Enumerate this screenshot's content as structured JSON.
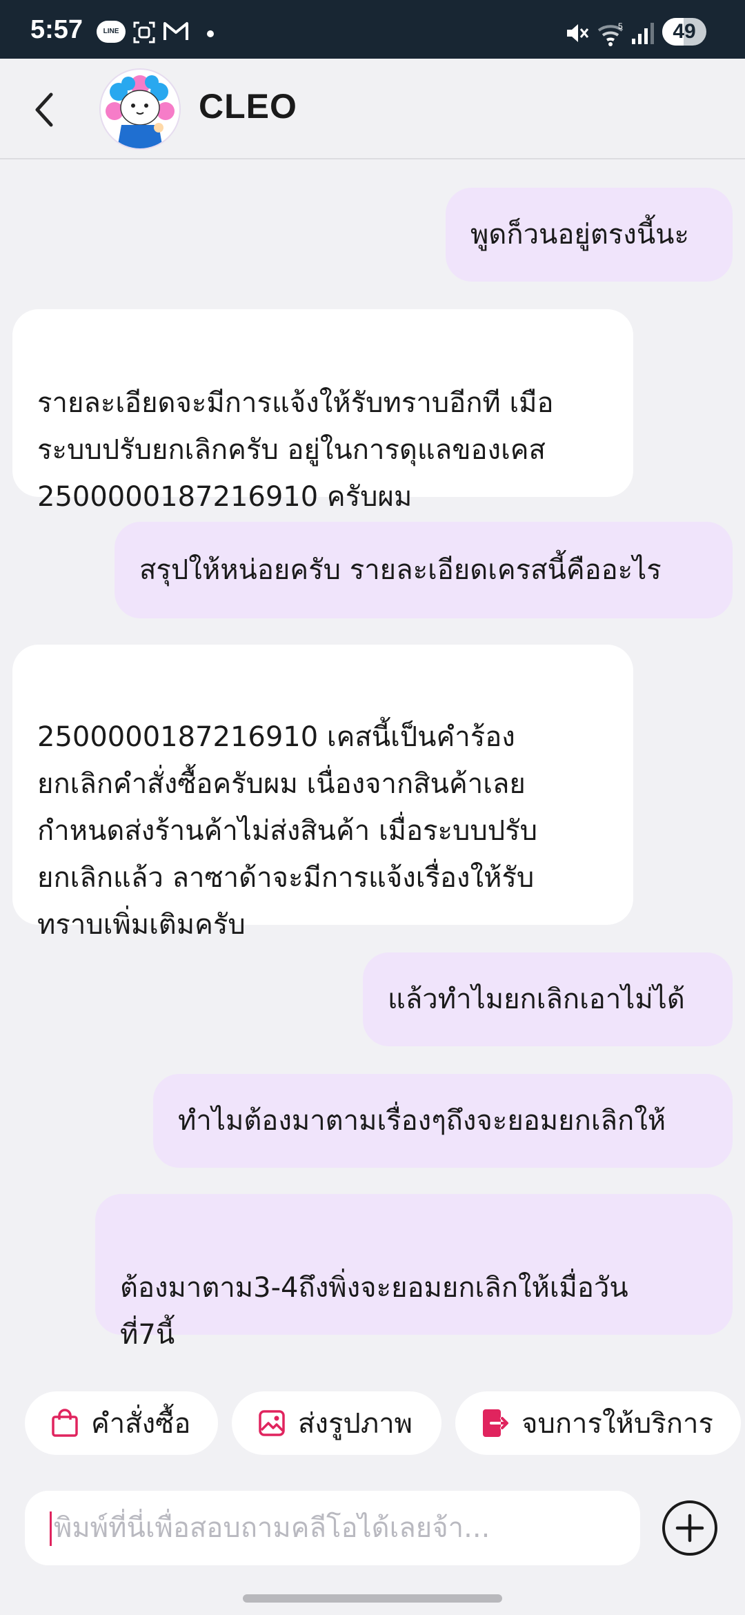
{
  "status_bar": {
    "time": "5:57",
    "line_icon_text": "LINE",
    "battery_level": "49",
    "battery_fraction": 0.49,
    "icons": [
      "line-app-icon",
      "scan-icon",
      "gmail-icon",
      "notification-dot",
      "mute-icon",
      "wifi-icon",
      "signal-icon",
      "battery-icon"
    ]
  },
  "header": {
    "title": "CLEO",
    "back_icon": "chevron-left-icon",
    "avatar": "cleo-avatar"
  },
  "messages": [
    {
      "sender": "user",
      "text": "พูดก็วนอยู่ตรงนี้นะ"
    },
    {
      "sender": "bot",
      "text": "รายละเอียดจะมีการแจ้งให้รับทราบอีกที เมือ\nระบบปรับยกเลิกครับ อยู่ในการดุแลของเคส\n2500000187216910 ครับผม"
    },
    {
      "sender": "user",
      "text": "สรุปให้หน่อยครับ รายละเอียดเครสนี้คืออะไร"
    },
    {
      "sender": "bot",
      "text": "2500000187216910 เคสนี้เป็นคำร้อง\nยกเลิกคำสั่งซื้อครับผม เนื่องจากสินค้าเลย\nกำหนดส่งร้านค้าไม่ส่งสินค้า เมื่อระบบปรับ\nยกเลิกแล้ว ลาซาด้าจะมีการแจ้งเรื่องให้รับ\nทราบเพิ่มเติมครับ"
    },
    {
      "sender": "user",
      "text": "แล้วทำไมยกเลิกเอาไม่ได้"
    },
    {
      "sender": "user",
      "text": "ทำไมต้องมาตามเรื่องๆถึงจะยอมยกเลิกให้"
    },
    {
      "sender": "user",
      "text": "ต้องมาตาม3-4ถึงพิ่งจะยอมยกเลิกให้เมื่อวัน\nที่7นี้"
    }
  ],
  "quick_actions": [
    {
      "label": "คำสั่งซื้อ",
      "icon": "shopping-bag-icon"
    },
    {
      "label": "ส่งรูปภาพ",
      "icon": "image-icon"
    },
    {
      "label": "จบการให้บริการ",
      "icon": "exit-icon"
    }
  ],
  "composer": {
    "placeholder": "พิมพ์ที่นี่เพื่อสอบถามคลีโอได้เลยจ้า...",
    "value": "",
    "plus_icon": "plus-circle-icon"
  },
  "colors": {
    "status_bar_bg": "#182633",
    "user_bubble": "#f0e4fb",
    "bot_bubble": "#ffffff",
    "chat_bg": "#f1f1f4",
    "accent": "#e0245e"
  }
}
